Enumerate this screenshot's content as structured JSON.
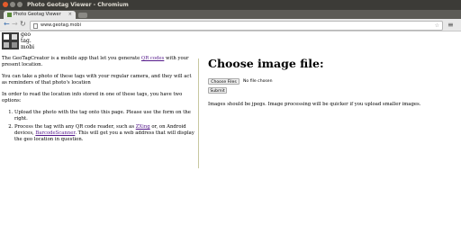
{
  "window": {
    "title": "Photo Geotag Viewer - Chromium"
  },
  "tab": {
    "title": "Photo Geotag Viewer",
    "close": "×"
  },
  "toolbar": {
    "url": "www.geotag.mobi",
    "back": "←",
    "forward": "→",
    "reload": "↻",
    "star": "☆",
    "menu": "≡"
  },
  "logo": {
    "line1": "geo",
    "line2": "tag.",
    "line3": "mobi"
  },
  "intro": {
    "p1_before": "The GeoTagCreator is a mobile app that let you generate ",
    "p1_link": "QR codes",
    "p1_after": " with your present location.",
    "p2": "You can take a photo of these tags with your regular camera, and they will act as reminders of that photo's location",
    "p3": "In order to read the location info stored in one of these tags, you have two options:"
  },
  "options": {
    "item1": "Upload the photo with the tag onto this page. Please use the form on the right.",
    "item2_before": "Process the tag with any QR code reader, such as ",
    "item2_link1": "ZXing",
    "item2_mid": " or, on Android devices, ",
    "item2_link2": "BarcodeScanner",
    "item2_after": ". This will get you a web address that will display the geo location in question."
  },
  "upload": {
    "heading": "Choose image file:",
    "choose_label": "Choose Files",
    "no_file": "No file chosen",
    "submit_label": "Submit",
    "note": "Images should be jpegs. Image processing will be quicker if you upload smaller images."
  },
  "colors": {
    "titlebar": "#3c3b37",
    "close_button": "#e45b2b",
    "link": "#551a8b"
  }
}
